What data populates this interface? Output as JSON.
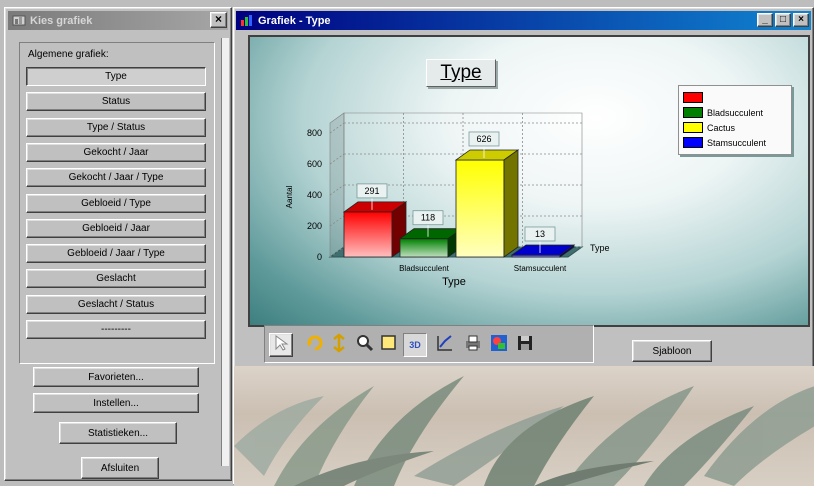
{
  "left_window": {
    "title": "Kies grafiek",
    "close": "×",
    "group_label": "Algemene grafiek:",
    "chart_buttons": [
      {
        "label": "Type",
        "pressed": true
      },
      {
        "label": "Status"
      },
      {
        "label": "Type / Status"
      },
      {
        "label": "Gekocht / Jaar"
      },
      {
        "label": "Gekocht / Jaar / Type"
      },
      {
        "label": "Gebloeid / Type"
      },
      {
        "label": "Gebloeid / Jaar"
      },
      {
        "label": "Gebloeid / Jaar / Type"
      },
      {
        "label": "Geslacht"
      },
      {
        "label": "Geslacht / Status"
      },
      {
        "label": "---------"
      }
    ],
    "favorieten": "Favorieten...",
    "instellen": "Instellen...",
    "statistieken": "Statistieken...",
    "afsluiten": "Afsluiten"
  },
  "right_window": {
    "title": "Grafiek - Type",
    "window_buttons": [
      "_",
      "□",
      "×"
    ],
    "sjabloon": "Sjabloon"
  },
  "chart_data": {
    "type": "bar",
    "title": "Type",
    "xlabel": "Type",
    "ylabel": "Aantal",
    "depth_axis_label": "Type",
    "categories": [
      "Bladsucculent",
      "Cactus",
      "Stamsucculent"
    ],
    "x_tick_labels": [
      "Bladsucculent",
      "Stamsucculent"
    ],
    "series": [
      {
        "name": "",
        "color": "#ff0000",
        "value": 291
      },
      {
        "name": "Bladsucculent",
        "color": "#008000",
        "value": 118
      },
      {
        "name": "Cactus",
        "color": "#ffff00",
        "value": 626
      },
      {
        "name": "Stamsucculent",
        "color": "#0000ff",
        "value": 13
      }
    ],
    "y_ticks": [
      0,
      200,
      400,
      600,
      800
    ],
    "ylim": [
      0,
      800
    ],
    "grid": true,
    "legend_position": "top-right",
    "view": "3D"
  },
  "toolbar": {
    "icons": [
      "pointer-icon",
      "rotate-icon",
      "axis-scale-icon",
      "zoom-icon",
      "frame-icon",
      "3d-toggle-icon",
      "chart-edit-icon",
      "print-icon",
      "image-icon",
      "save-icon"
    ],
    "three_d_label": "3D"
  }
}
